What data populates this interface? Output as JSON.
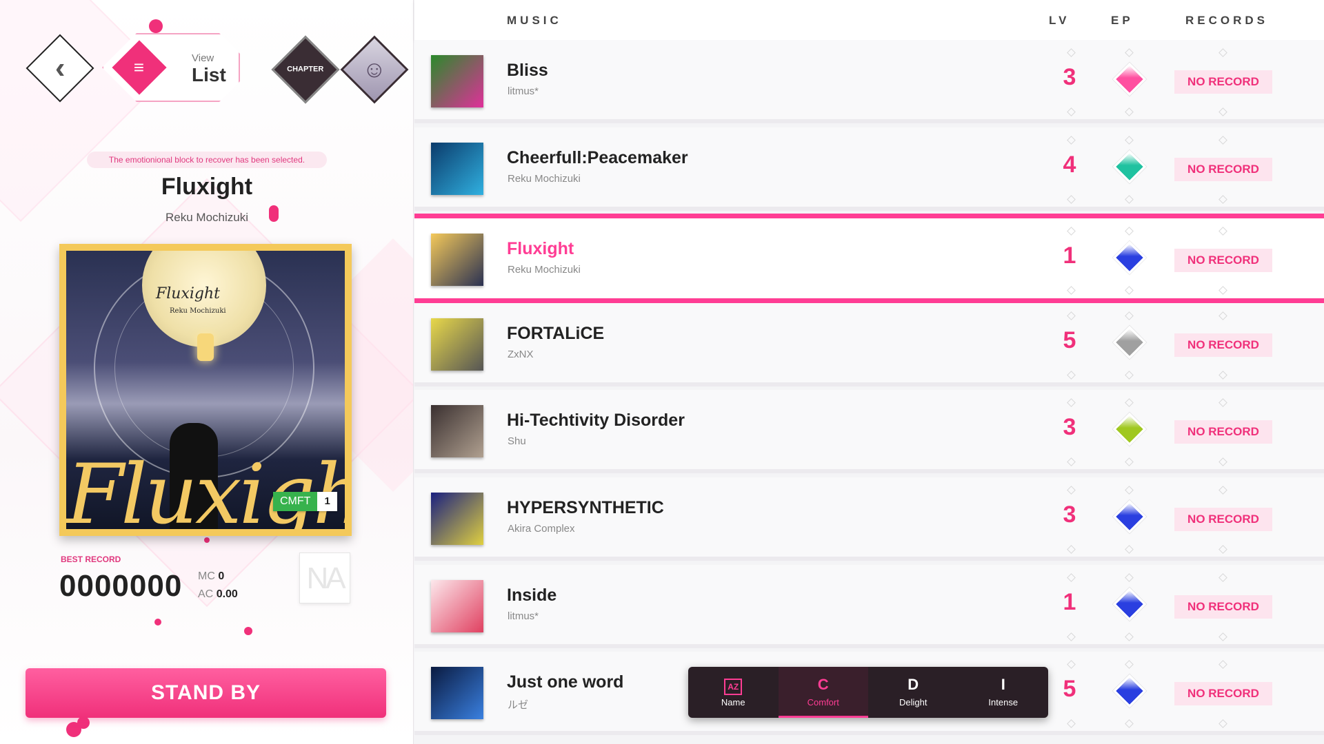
{
  "nav": {
    "view_small": "View",
    "view_large": "List",
    "chapter_label": "CHAPTER"
  },
  "selected": {
    "notice": "The emotionional block to recover has been selected.",
    "title": "Fluxight",
    "artist": "Reku Mochizuki",
    "jacket_logo": "Fluxight",
    "jacket_sub": "Reku Mochizuki",
    "difficulty_label": "CMFT",
    "difficulty_level": "1",
    "best_record_label": "BEST RECORD",
    "score": "0000000",
    "mc_label": "MC",
    "mc_value": "0",
    "ac_label": "AC",
    "ac_value": "0.00",
    "rank": "NA"
  },
  "standby_label": "STAND BY",
  "header": {
    "music": "MUSIC",
    "lv": "LV",
    "ep": "EP",
    "records": "RECORDS"
  },
  "songs": [
    {
      "title": "Bliss",
      "artist": "litmus*",
      "lv": "3",
      "ep_color": "#ff4fa0",
      "record": "NO RECORD",
      "thumb": [
        "#2a8a2a",
        "#e0309a"
      ]
    },
    {
      "title": "Cheerfull:Peacemaker",
      "artist": "Reku Mochizuki",
      "lv": "4",
      "ep_color": "#1fc2a0",
      "record": "NO RECORD",
      "thumb": [
        "#0b3b6b",
        "#30b0e0"
      ]
    },
    {
      "title": "Fluxight",
      "artist": "Reku Mochizuki",
      "lv": "1",
      "ep_color": "#2a3fe0",
      "record": "NO RECORD",
      "thumb": [
        "#f4c95a",
        "#2a3152"
      ],
      "selected": true
    },
    {
      "title": "FORTALiCE",
      "artist": "ZxNX",
      "lv": "5",
      "ep_color": "#a0a0a0",
      "record": "NO RECORD",
      "thumb": [
        "#e8d84a",
        "#555555"
      ]
    },
    {
      "title": "Hi-Techtivity Disorder",
      "artist": "Shu",
      "lv": "3",
      "ep_color": "#a0c820",
      "record": "NO RECORD",
      "thumb": [
        "#3a3030",
        "#b0a090"
      ]
    },
    {
      "title": "HYPERSYNTHETIC",
      "artist": "Akira Complex",
      "lv": "3",
      "ep_color": "#2a3fe0",
      "record": "NO RECORD",
      "thumb": [
        "#1a2080",
        "#e0d040"
      ]
    },
    {
      "title": "Inside",
      "artist": "litmus*",
      "lv": "1",
      "ep_color": "#2a3fe0",
      "record": "NO RECORD",
      "thumb": [
        "#fce8ec",
        "#e04060"
      ]
    },
    {
      "title": "Just one word",
      "artist": "ルゼ",
      "lv": "5",
      "ep_color": "#2a3fe0",
      "record": "NO RECORD",
      "thumb": [
        "#0a1a40",
        "#3a80e0"
      ]
    }
  ],
  "sort": [
    {
      "icon": "AZ",
      "label": "Name",
      "active": false
    },
    {
      "icon": "C",
      "label": "Comfort",
      "active": true
    },
    {
      "icon": "D",
      "label": "Delight",
      "active": false
    },
    {
      "icon": "I",
      "label": "Intense",
      "active": false
    }
  ]
}
